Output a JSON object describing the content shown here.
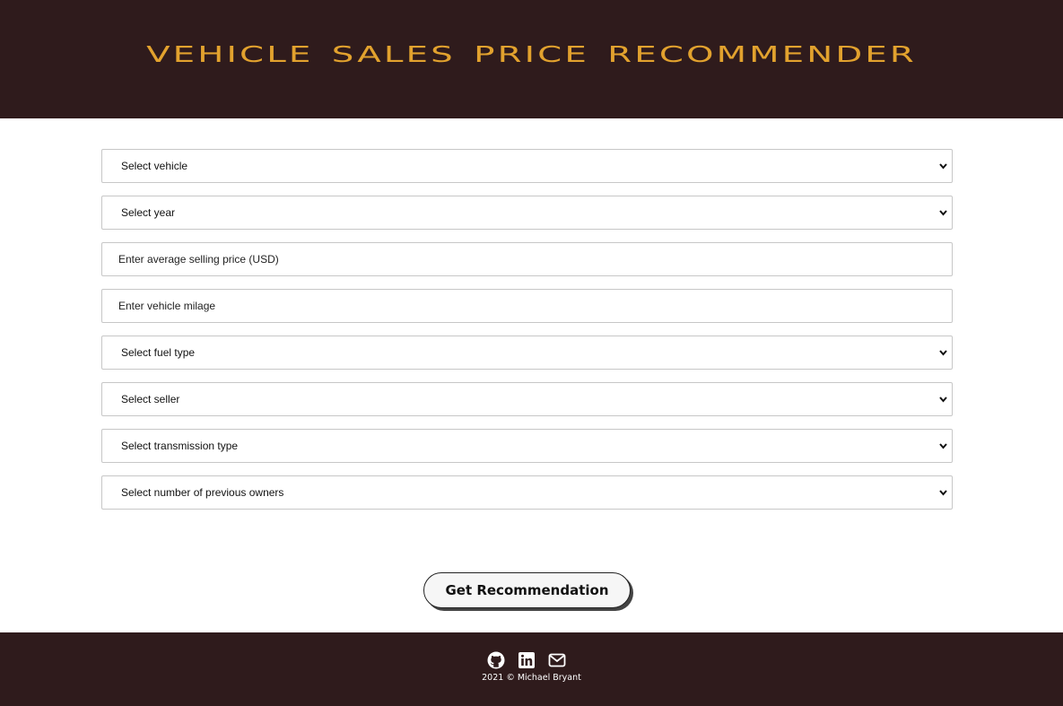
{
  "header": {
    "title": "Vehicle Sales Price Recommender"
  },
  "form": {
    "vehicle": "Select vehicle",
    "year": "Select year",
    "price_placeholder": "Enter average selling price (USD)",
    "milage_placeholder": "Enter vehicle milage",
    "fuel": "Select fuel type",
    "seller": "Select seller",
    "transmission": "Select transmission type",
    "owners": "Select number of previous owners",
    "submit_label": "Get Recommendation"
  },
  "footer": {
    "icons": [
      "github-icon",
      "linkedin-icon",
      "mail-icon"
    ],
    "copyright": "2021 © Michael Bryant"
  },
  "colors": {
    "header_bg": "#2f1b1c",
    "title": "#e2a22e",
    "footer_bg": "#2f1b1c"
  }
}
